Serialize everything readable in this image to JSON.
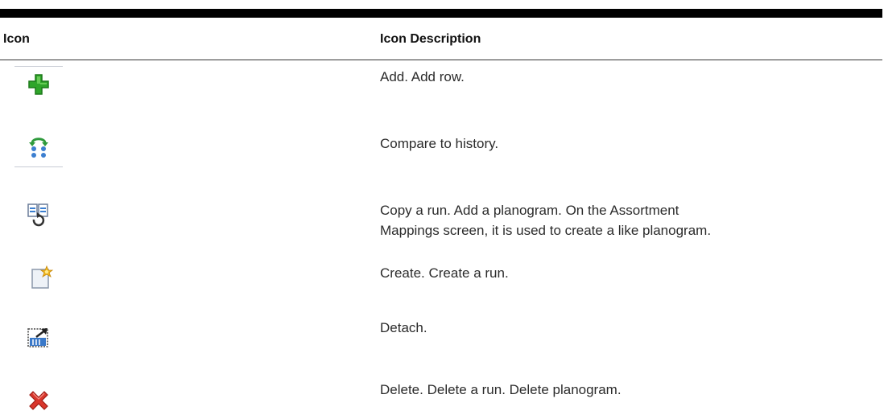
{
  "table": {
    "headers": [
      "Icon",
      "Icon Description"
    ],
    "rows": [
      {
        "icon": "add-icon",
        "description": "Add. Add row."
      },
      {
        "icon": "compare-history-icon",
        "description": "Compare to history."
      },
      {
        "icon": "copy-run-icon",
        "description": "Copy a run. Add a planogram. On the Assortment Mappings screen, it is used to create a like planogram."
      },
      {
        "icon": "create-icon",
        "description": "Create. Create a run."
      },
      {
        "icon": "detach-icon",
        "description": "Detach."
      },
      {
        "icon": "delete-icon",
        "description": "Delete. Delete a run. Delete planogram."
      }
    ]
  },
  "colors": {
    "add_green": "#2fa52a",
    "delete_red": "#d9362c",
    "compare_green": "#2e9a3c",
    "compare_blue": "#3c7fd0",
    "create_star": "#f2b81c",
    "detach_blue": "#3a79c9"
  }
}
